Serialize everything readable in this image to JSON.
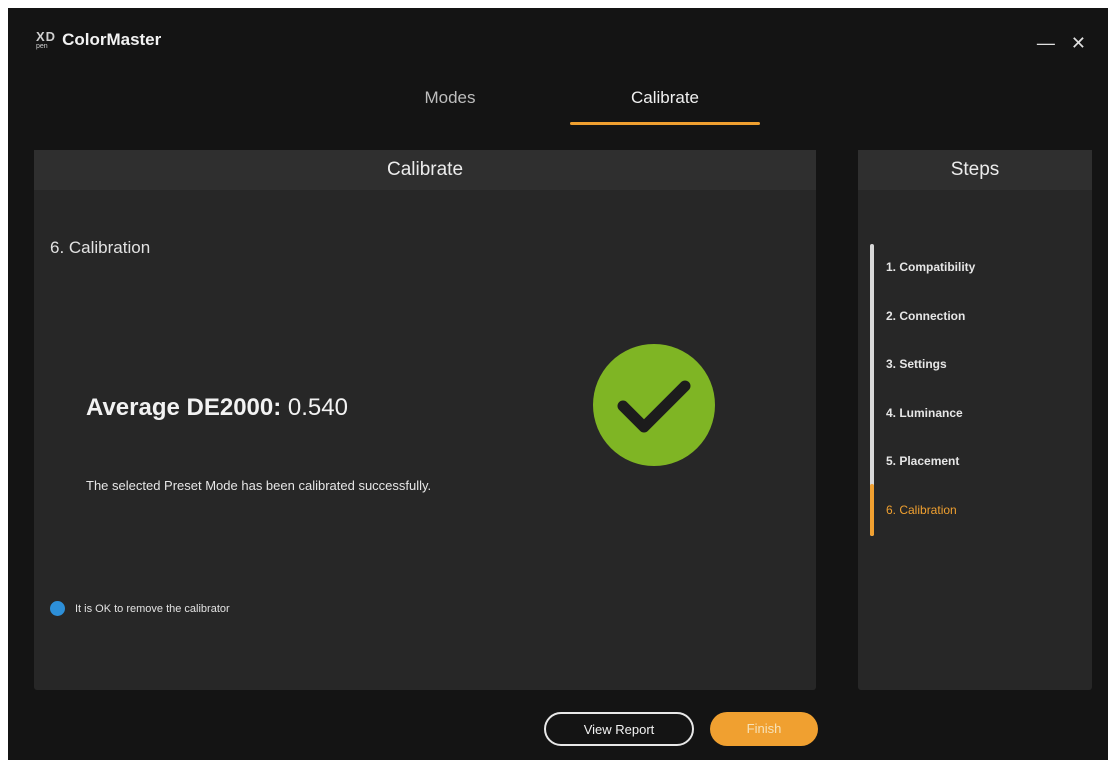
{
  "app": {
    "logo_top": "XD",
    "logo_bottom": "pen",
    "name": "ColorMaster",
    "minimize_glyph": "—",
    "close_glyph": "✕"
  },
  "tabs": [
    {
      "label": "Modes",
      "active": false
    },
    {
      "label": "Calibrate",
      "active": true
    }
  ],
  "main": {
    "header": "Calibrate",
    "section_title": "6. Calibration",
    "result_label": "Average DE2000:",
    "result_value": "0.540",
    "message": "The selected Preset Mode has been calibrated successfully.",
    "info_text": "It is OK to remove the calibrator",
    "success_color": "#7fb524",
    "info_color": "#2d8fd8"
  },
  "steps": {
    "header": "Steps",
    "items": [
      {
        "label": "1. Compatibility",
        "active": false
      },
      {
        "label": "2. Connection",
        "active": false
      },
      {
        "label": "3. Settings",
        "active": false
      },
      {
        "label": "4. Luminance",
        "active": false
      },
      {
        "label": "5. Placement",
        "active": false
      },
      {
        "label": "6. Calibration",
        "active": true
      }
    ]
  },
  "buttons": {
    "view_report": "View Report",
    "finish": "Finish"
  },
  "accent_color": "#f0a030"
}
